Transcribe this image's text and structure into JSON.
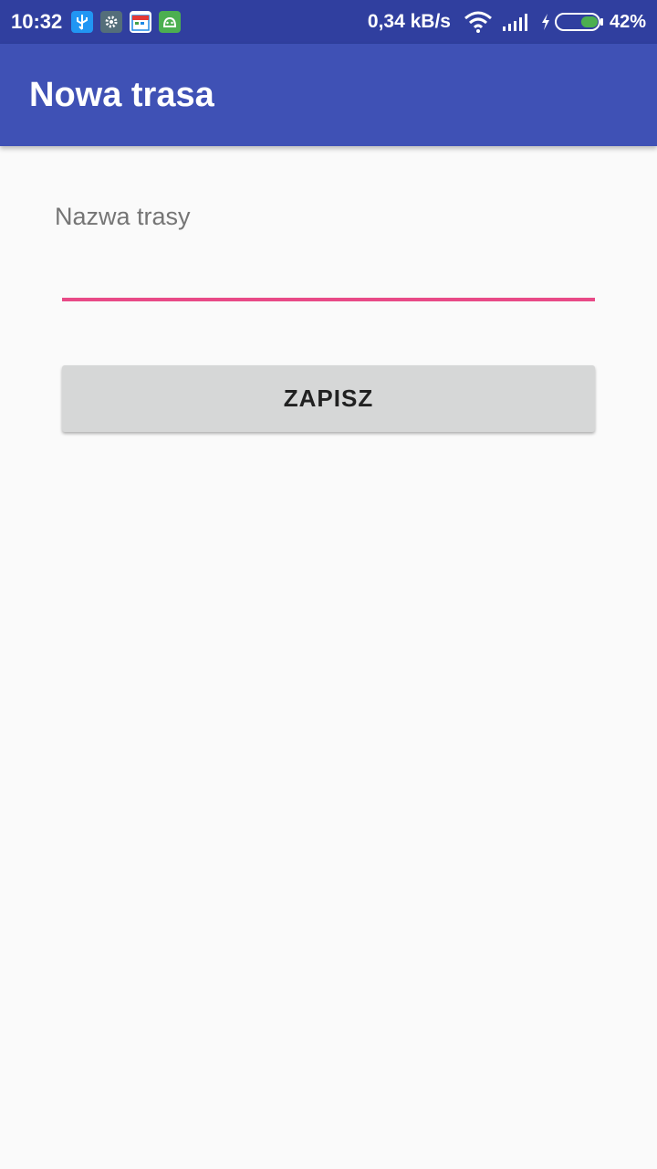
{
  "status_bar": {
    "time": "10:32",
    "net_speed": "0,34 kB/s",
    "battery_percent": "42%",
    "battery_level": 0.42,
    "notification_icons": [
      "usb-icon",
      "gear-icon",
      "calendar-icon",
      "android-icon"
    ],
    "system_icons": [
      "wifi-icon",
      "signal-icon",
      "charging-icon",
      "battery-icon"
    ],
    "colors": {
      "background": "#303f9f"
    }
  },
  "app_bar": {
    "title": "Nowa trasa",
    "colors": {
      "background": "#3f51b5",
      "text": "#ffffff"
    }
  },
  "form": {
    "route_name_label": "Nazwa trasy",
    "route_name_value": "",
    "save_label": "ZAPISZ",
    "colors": {
      "underline_accent": "#e84a87",
      "button_bg": "#d6d7d7"
    }
  }
}
